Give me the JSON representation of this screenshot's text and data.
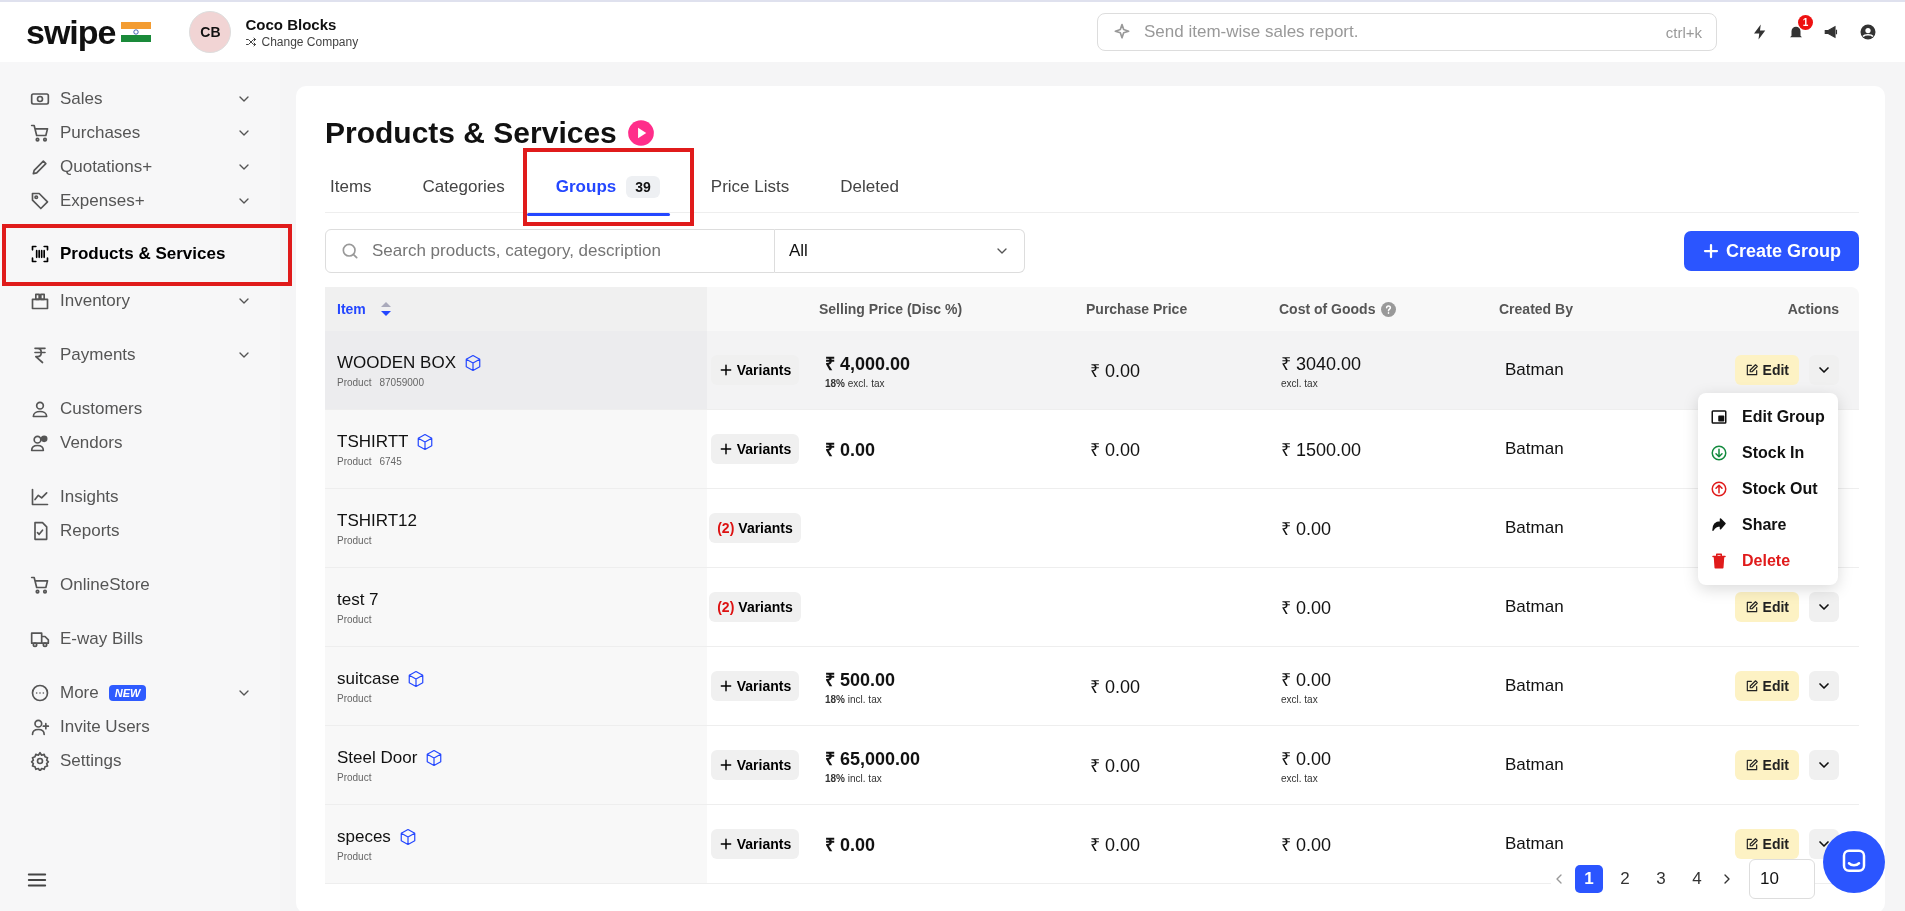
{
  "header": {
    "logo": "swipe",
    "company": {
      "initials": "CB",
      "name": "Coco Blocks",
      "action": "Change Company"
    },
    "search": {
      "placeholder": "Send item-wise sales report.",
      "shortcut": "ctrl+k"
    },
    "notifications": "1"
  },
  "sidebar": {
    "sections": [
      {
        "items": [
          {
            "label": "Sales",
            "chevron": true,
            "selected": false,
            "annotated": false
          },
          {
            "label": "Purchases",
            "chevron": true,
            "selected": false,
            "annotated": false
          },
          {
            "label": "Quotations+",
            "chevron": true,
            "selected": false,
            "annotated": false
          },
          {
            "label": "Expenses+",
            "chevron": true,
            "selected": false,
            "annotated": false
          }
        ]
      },
      {
        "items": [
          {
            "label": "Products & Services",
            "chevron": false,
            "selected": true,
            "annotated": true
          },
          {
            "label": "Inventory",
            "chevron": true,
            "selected": false,
            "annotated": false
          }
        ]
      },
      {
        "items": [
          {
            "label": "Payments",
            "chevron": true,
            "selected": false,
            "annotated": false
          }
        ]
      },
      {
        "items": [
          {
            "label": "Customers",
            "chevron": false,
            "selected": false,
            "annotated": false
          },
          {
            "label": "Vendors",
            "chevron": false,
            "selected": false,
            "annotated": false
          }
        ]
      },
      {
        "items": [
          {
            "label": "Insights",
            "chevron": false,
            "selected": false,
            "annotated": false
          },
          {
            "label": "Reports",
            "chevron": false,
            "selected": false,
            "annotated": false
          }
        ]
      },
      {
        "items": [
          {
            "label": "OnlineStore",
            "chevron": false,
            "selected": false,
            "annotated": false
          }
        ]
      },
      {
        "items": [
          {
            "label": "E-way Bills",
            "chevron": false,
            "selected": false,
            "annotated": false
          }
        ]
      },
      {
        "items": [
          {
            "label": "More",
            "chevron": true,
            "badge": "NEW",
            "selected": false,
            "annotated": false
          },
          {
            "label": "Invite Users",
            "chevron": false,
            "selected": false,
            "annotated": false
          },
          {
            "label": "Settings",
            "chevron": false,
            "selected": false,
            "annotated": false
          }
        ]
      }
    ]
  },
  "page": {
    "title": "Products & Services",
    "tabs": [
      {
        "label": "Items",
        "selected": false,
        "annotated": false
      },
      {
        "label": "Categories",
        "selected": false,
        "annotated": false
      },
      {
        "label": "Groups",
        "count": "39",
        "selected": true,
        "annotated": true
      },
      {
        "label": "Price Lists",
        "selected": false,
        "annotated": false
      },
      {
        "label": "Deleted",
        "selected": false,
        "annotated": false
      }
    ],
    "search": {
      "placeholder": "Search products, category, description"
    },
    "filter": {
      "value": "All"
    },
    "create_button": "Create Group",
    "table": {
      "columns": [
        "Item",
        "",
        "Selling Price (Disc %)",
        "Purchase Price",
        "Cost of Goods",
        "Created By",
        "Actions"
      ],
      "rows": [
        {
          "name": "WOODEN BOX",
          "cube": true,
          "type": "Product",
          "code": "87059000",
          "variants": {
            "kind": "add",
            "label": "Variants"
          },
          "selling": {
            "price": "₹ 4,000.00",
            "disc": "18%",
            "tax": "excl. tax"
          },
          "purchase": "₹ 0.00",
          "cost": {
            "value": "₹ 3040.00",
            "note": "excl. tax"
          },
          "created_by": "Batman",
          "edit": "Edit",
          "hovered": true
        },
        {
          "name": "TSHIRTT",
          "cube": true,
          "type": "Product",
          "code": "6745",
          "variants": {
            "kind": "add",
            "label": "Variants"
          },
          "selling": {
            "price": "₹ 0.00"
          },
          "purchase": "₹ 0.00",
          "cost": {
            "value": "₹ 1500.00"
          },
          "created_by": "Batman",
          "hovered": false
        },
        {
          "name": "TSHIRT12",
          "cube": false,
          "type": "Product",
          "variants": {
            "kind": "count",
            "count": "(2)",
            "label": "Variants"
          },
          "cost": {
            "value": "₹ 0.00"
          },
          "created_by": "Batman",
          "hovered": false
        },
        {
          "name": "test 7",
          "cube": false,
          "type": "Product",
          "variants": {
            "kind": "count",
            "count": "(2)",
            "label": "Variants"
          },
          "cost": {
            "value": "₹ 0.00"
          },
          "created_by": "Batman",
          "edit": "Edit",
          "hovered": false
        },
        {
          "name": "suitcase",
          "cube": true,
          "type": "Product",
          "variants": {
            "kind": "add",
            "label": "Variants"
          },
          "selling": {
            "price": "₹ 500.00",
            "disc": "18%",
            "tax": "incl. tax"
          },
          "purchase": "₹ 0.00",
          "cost": {
            "value": "₹ 0.00",
            "note": "excl. tax"
          },
          "created_by": "Batman",
          "edit": "Edit",
          "hovered": false
        },
        {
          "name": "Steel Door",
          "cube": true,
          "type": "Product",
          "variants": {
            "kind": "add",
            "label": "Variants"
          },
          "selling": {
            "price": "₹ 65,000.00",
            "disc": "18%",
            "tax": "incl. tax"
          },
          "purchase": "₹ 0.00",
          "cost": {
            "value": "₹ 0.00",
            "note": "excl. tax"
          },
          "created_by": "Batman",
          "edit": "Edit",
          "hovered": false
        },
        {
          "name": "speces",
          "cube": true,
          "type": "Product",
          "variants": {
            "kind": "add",
            "label": "Variants"
          },
          "selling": {
            "price": "₹ 0.00"
          },
          "purchase": "₹ 0.00",
          "cost": {
            "value": "₹ 0.00"
          },
          "created_by": "Batman",
          "edit": "Edit",
          "hovered": false
        }
      ]
    },
    "menu": [
      {
        "kind": "edit",
        "label": "Edit Group"
      },
      {
        "kind": "in",
        "label": "Stock In"
      },
      {
        "kind": "out",
        "label": "Stock Out"
      },
      {
        "kind": "share",
        "label": "Share"
      },
      {
        "kind": "delete",
        "label": "Delete"
      }
    ],
    "pagination": {
      "pages": [
        {
          "label": "1",
          "selected": true
        },
        {
          "label": "2",
          "selected": false
        },
        {
          "label": "3",
          "selected": false
        },
        {
          "label": "4",
          "selected": false
        }
      ],
      "page_size": "10"
    }
  }
}
